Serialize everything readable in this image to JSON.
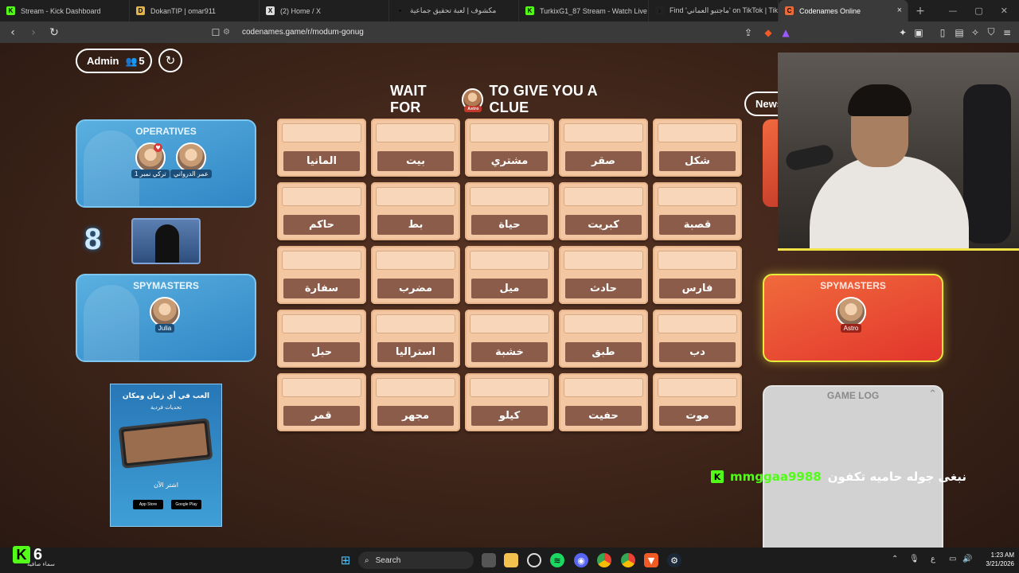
{
  "browser": {
    "tabs": [
      {
        "label": "Stream - Kick Dashboard",
        "fav": "K",
        "fav_color": "#53fc18"
      },
      {
        "label": "DokanTIP | omar911",
        "fav": "D",
        "fav_color": "#e2b34a"
      },
      {
        "label": "(2) Home / X",
        "fav": "X",
        "fav_color": "#dddddd"
      },
      {
        "label": "مكشوف | لعبة تحقيق جماعية",
        "fav": "•",
        "fav_color": "#1f1f1f"
      },
      {
        "label": "TurkixG1_87 Stream - Watch Live on",
        "fav": "K",
        "fav_color": "#53fc18"
      },
      {
        "label": "Find 'ماجتبو العماني' on TikTok | TikT",
        "fav": "♪",
        "fav_color": "#222222"
      },
      {
        "label": "Codenames Online",
        "fav": "C",
        "fav_color": "#e86a3a"
      }
    ],
    "new_tab": "+",
    "url": "codenames.game/r/modum-gonug"
  },
  "game": {
    "admin_label": "Admin",
    "player_count": "5",
    "news_label": "News",
    "banner_pre": "WAIT FOR",
    "banner_post": "TO GIVE YOU A CLUE",
    "banner_avatar_tag": "Astro",
    "blue_team": {
      "operatives_title": "OPERATIVES",
      "operatives": [
        "تركي نمبر 1",
        "عمر الدرواني"
      ],
      "cards_left": "8",
      "spymasters_title": "SPYMASTERS",
      "spymaster": "Julia"
    },
    "red_team": {
      "spymasters_title": "SPYMASTERS",
      "spymaster": "Astro"
    },
    "gamelog_title": "GAME LOG",
    "board": [
      "المانيا",
      "بيت",
      "مشتري",
      "صقر",
      "شكل",
      "حاكم",
      "بط",
      "حياة",
      "كبريت",
      "قصبة",
      "سفارة",
      "مضرب",
      "ميل",
      "حادث",
      "فارس",
      "حبل",
      "استراليا",
      "خشبة",
      "طبق",
      "دب",
      "قمر",
      "مجهر",
      "كيلو",
      "حفيت",
      "موت"
    ],
    "ad": {
      "headline": "العب في أي زمان ومكان",
      "subline": "تحديات فردية",
      "cta": "اشتر الآن",
      "store1": "App Store",
      "store2": "Google Play"
    }
  },
  "overlay": {
    "chat_user": "mmggaa9988",
    "chat_msg": "نبغى جوله حاميه تكفون",
    "kick_count": "6",
    "kick_sub": "سماء صافية"
  },
  "taskbar": {
    "search_label": "Search",
    "time": "1:23 AM",
    "date": "3/21/2026",
    "lang": "ع"
  }
}
